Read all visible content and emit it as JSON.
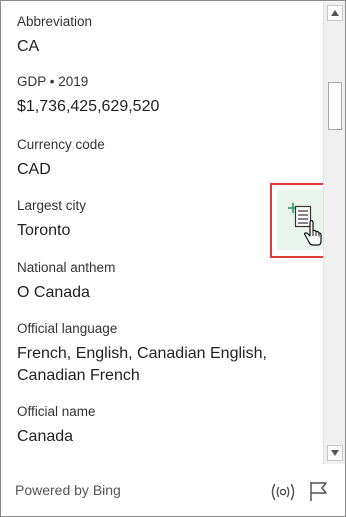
{
  "fields": [
    {
      "label": "Abbreviation",
      "value": "CA"
    },
    {
      "label": "GDP • 2019",
      "value": "$1,736,425,629,520"
    },
    {
      "label": "Currency code",
      "value": "CAD"
    },
    {
      "label": "Largest city",
      "value": "Toronto"
    },
    {
      "label": "National anthem",
      "value": "O Canada"
    },
    {
      "label": "Official language",
      "value": "French, English, Canadian English, Canadian French"
    },
    {
      "label": "Official name",
      "value": "Canada"
    }
  ],
  "footer": {
    "powered_by": "Powered by Bing"
  },
  "icons": {
    "insert": "insert-data-icon",
    "pointer": "hand-pointer-icon",
    "broadcast": "broadcast-icon",
    "flag": "flag-icon"
  },
  "colors": {
    "highlight": "#e03c3c",
    "insert_bg": "#e8f4ec",
    "insert_accent": "#2e9b56"
  }
}
